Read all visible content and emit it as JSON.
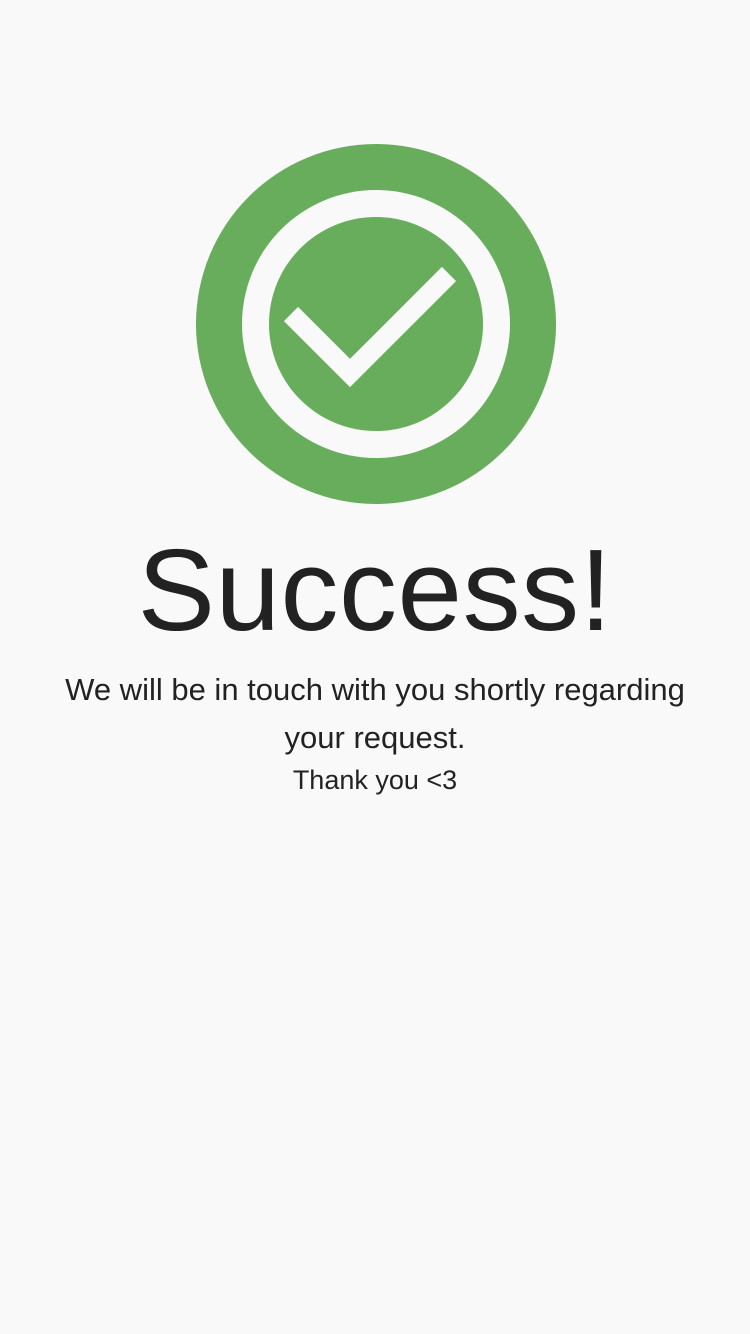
{
  "colors": {
    "background": "#f9f9f9",
    "accent": "#68ad5c",
    "text": "#222222"
  },
  "icon": {
    "name": "checkmark-circle-icon"
  },
  "title": "Success!",
  "message": "We will be in touch with you shortly regarding your request.",
  "thanks": "Thank you <3"
}
